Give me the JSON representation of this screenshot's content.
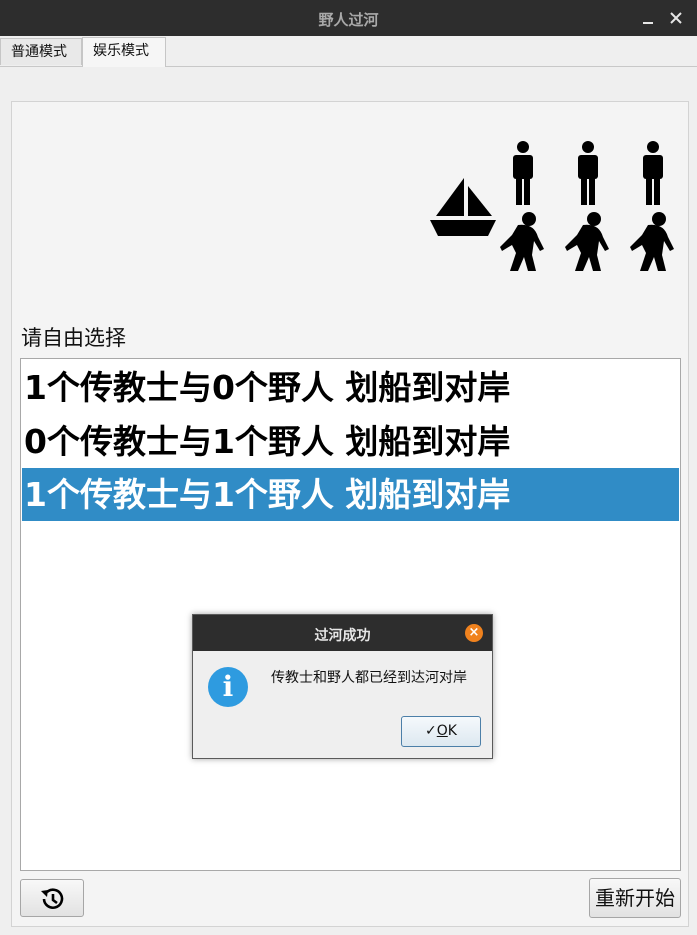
{
  "window": {
    "title": "野人过河",
    "minimize_icon": "minimize-icon",
    "close_icon": "close-icon"
  },
  "tabs": [
    {
      "label": "普通模式",
      "active": false
    },
    {
      "label": "娱乐模式",
      "active": true
    }
  ],
  "scene": {
    "boat_icon": "sailboat-icon",
    "missionaries_right": 3,
    "savages_right": 3,
    "missionary_icon": "person-icon",
    "savage_icon": "bigfoot-icon"
  },
  "main": {
    "prompt": "请自由选择",
    "options": [
      {
        "label": "1个传教士与0个野人  划船到对岸",
        "selected": false
      },
      {
        "label": "0个传教士与1个野人  划船到对岸",
        "selected": false
      },
      {
        "label": "1个传教士与1个野人  划船到对岸",
        "selected": true
      }
    ],
    "history_icon": "history-icon",
    "restart_label": "重新开始"
  },
  "dialog": {
    "title": "过河成功",
    "message": "传教士和野人都已经到达河对岸",
    "info_glyph": "i",
    "ok_check": "✓",
    "ok_label": "OK",
    "ok_mnemonic": "O",
    "ok_rest": "K"
  },
  "colors": {
    "titlebar": "#2d2d2d",
    "selection": "#308cc6",
    "dialog_close": "#f0821e",
    "info": "#2e9be0"
  }
}
